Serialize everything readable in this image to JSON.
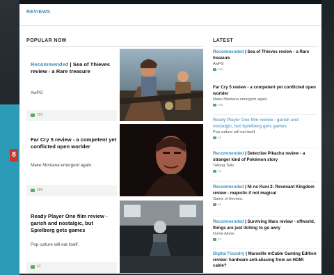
{
  "nav": {
    "reviews_label": "REVIEWS"
  },
  "side_tag": "8",
  "popular": {
    "label": "POPULAR NOW",
    "cards": [
      {
        "tag": "Recommended",
        "title": " | Sea of Thieves review - a Rare treasure",
        "sub": "AwPG",
        "comments": "265"
      },
      {
        "tag": "",
        "title": "Far Cry 5 review - a competent yet conflicted open worlder",
        "sub": "Make Montana emergent again.",
        "comments": "269"
      },
      {
        "tag": "",
        "title": "Ready Player One film review - garish and nostalgic, but Spielberg gets games",
        "sub": "Pop culture will eat itself.",
        "comments": "43"
      }
    ]
  },
  "latest": {
    "label": "LATEST",
    "items": [
      {
        "tag": "Recommended",
        "title": " | Sea of Thieves review - a Rare treasure",
        "sub": "AwPG",
        "comments": "265",
        "muted": false
      },
      {
        "tag": "",
        "title": "Far Cry 5 review - a competent yet conflicted open worlder",
        "sub": "Make Montana emergent again.",
        "comments": "269",
        "muted": false
      },
      {
        "tag": "",
        "title": "Ready Player One film review - garish and nostalgic, but Spielberg gets games",
        "sub": "Pop culture will eat itself.",
        "comments": "43",
        "muted": true
      },
      {
        "tag": "Recommended",
        "title": " | Detective Pikachu review - a stranger kind of Pokémon story",
        "sub": "Talking Tails.",
        "comments": "12",
        "muted": false
      },
      {
        "tag": "Recommended",
        "title": " | Ni no Kuni 2: Revenant Kingdom review - majestic if not magical",
        "sub": "Game of thrones.",
        "comments": "48",
        "muted": false
      },
      {
        "tag": "Recommended",
        "title": " | Surviving Mars review - offworld, things are just itching to go awry",
        "sub": "Dome Alone.",
        "comments": "21",
        "muted": false
      },
      {
        "tag": "Digital Foundry",
        "title": " | Marseille mCable Gaming Edition review: hardware anti-aliasing from an HDMI cable?",
        "sub": "",
        "comments": "",
        "muted": false
      }
    ]
  }
}
